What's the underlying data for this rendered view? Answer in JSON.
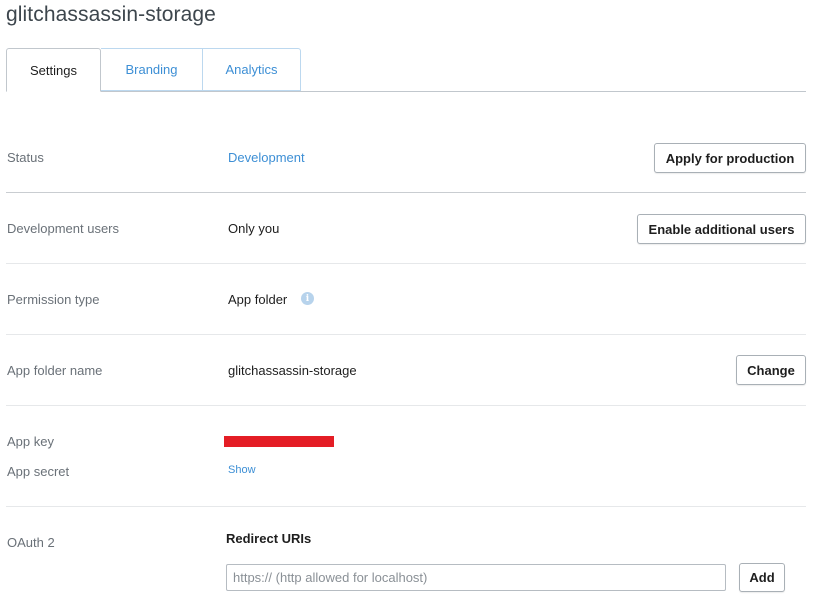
{
  "app": {
    "title": "glitchassassin-storage"
  },
  "tabs": [
    {
      "label": "Settings"
    },
    {
      "label": "Branding"
    },
    {
      "label": "Analytics"
    }
  ],
  "status": {
    "label": "Status",
    "value": "Development",
    "button": "Apply for production"
  },
  "dev_users": {
    "label": "Development users",
    "value": "Only you",
    "button": "Enable additional users"
  },
  "permission": {
    "label": "Permission type",
    "value": "App folder",
    "icon": "info-icon"
  },
  "app_folder": {
    "label": "App folder name",
    "value": "glitchassassin-storage",
    "button": "Change"
  },
  "credentials": {
    "key_label": "App key",
    "secret_label": "App secret",
    "show_link": "Show",
    "redaction_color": "#e41d25"
  },
  "oauth": {
    "label": "OAuth 2",
    "redirect_heading": "Redirect URIs",
    "input_placeholder": "https:// (http allowed for localhost)",
    "input_value": "",
    "add_button": "Add"
  },
  "colors": {
    "link": "#3d8fd5",
    "text": "#1e1e1e",
    "muted": "#6a7178"
  }
}
